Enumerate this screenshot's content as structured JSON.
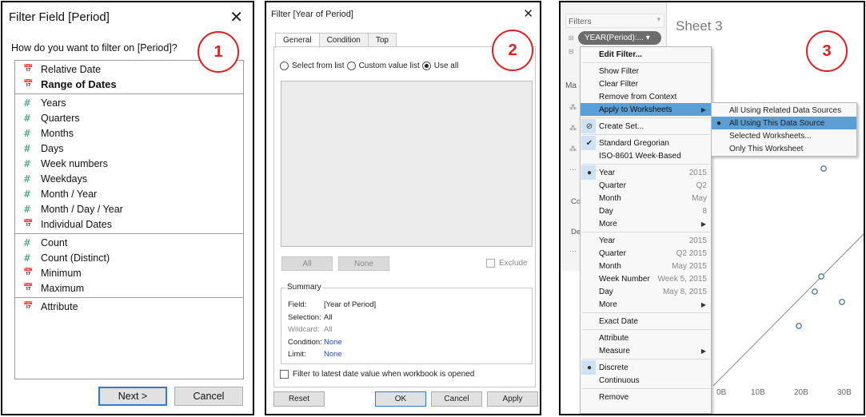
{
  "badges": [
    "1",
    "2",
    "3"
  ],
  "filter_field": {
    "title": "Filter Field [Period]",
    "close_glyph": "✕",
    "question": "How do you want to filter on [Period]?",
    "groups": [
      [
        {
          "label": "Relative Date",
          "icon": "calendar-icon",
          "glyph": "📅"
        },
        {
          "label": "Range of Dates",
          "icon": "calendar-icon",
          "glyph": "📅",
          "bold": true
        }
      ],
      [
        {
          "label": "Years",
          "icon": "hash-icon",
          "glyph": "#"
        },
        {
          "label": "Quarters",
          "icon": "hash-icon",
          "glyph": "#"
        },
        {
          "label": "Months",
          "icon": "hash-icon",
          "glyph": "#"
        },
        {
          "label": "Days",
          "icon": "hash-icon",
          "glyph": "#"
        },
        {
          "label": "Week numbers",
          "icon": "hash-icon",
          "glyph": "#"
        },
        {
          "label": "Weekdays",
          "icon": "hash-icon",
          "glyph": "#"
        },
        {
          "label": "Month / Year",
          "icon": "hash-icon",
          "glyph": "#"
        },
        {
          "label": "Month / Day / Year",
          "icon": "hash-icon",
          "glyph": "#"
        },
        {
          "label": "Individual Dates",
          "icon": "calendar-icon",
          "glyph": "📅"
        }
      ],
      [
        {
          "label": "Count",
          "icon": "hash-icon",
          "glyph": "#"
        },
        {
          "label": "Count (Distinct)",
          "icon": "hash-icon",
          "glyph": "#"
        },
        {
          "label": "Minimum",
          "icon": "calendar-icon",
          "glyph": "📅"
        },
        {
          "label": "Maximum",
          "icon": "calendar-icon",
          "glyph": "📅"
        }
      ],
      [
        {
          "label": "Attribute",
          "icon": "calendar-icon",
          "glyph": "📅"
        }
      ]
    ],
    "next_label": "Next >",
    "cancel_label": "Cancel"
  },
  "filter_year": {
    "title": "Filter [Year of Period]",
    "close_glyph": "✕",
    "tabs": [
      "General",
      "Condition",
      "Top"
    ],
    "active_tab": "General",
    "radios": [
      {
        "label": "Select from list",
        "selected": false
      },
      {
        "label": "Custom value list",
        "selected": false
      },
      {
        "label": "Use all",
        "selected": true
      }
    ],
    "all_label": "All",
    "none_label": "None",
    "exclude_label": "Exclude",
    "summary": {
      "legend": "Summary",
      "field_key": "Field:",
      "field_val": "[Year of Period]",
      "selection_key": "Selection:",
      "selection_val": "All",
      "wildcard_key": "Wildcard:",
      "wildcard_val": "All",
      "condition_key": "Condition:",
      "condition_val": "None",
      "limit_key": "Limit:",
      "limit_val": "None"
    },
    "latest_label": "Filter to latest date value when workbook is opened",
    "reset_label": "Reset",
    "ok_label": "OK",
    "cancel_label": "Cancel",
    "apply_label": "Apply"
  },
  "worksheet": {
    "filters_label": "Filters",
    "pill_label": "YEAR(Period):... ▾",
    "marks_stub": "Ma",
    "color_stub": "Co",
    "detail_stub": "De",
    "sheet_title": "Sheet 3",
    "x_ticks": [
      "0B",
      "10B",
      "20B",
      "30B"
    ],
    "menu": [
      {
        "label": "Edit Filter...",
        "bold": true
      },
      {
        "sep": true
      },
      {
        "label": "Show Filter"
      },
      {
        "label": "Clear Filter"
      },
      {
        "label": "Remove from Context"
      },
      {
        "label": "Apply to Worksheets",
        "submenu": true,
        "highlight": true
      },
      {
        "sep": true
      },
      {
        "label": "Create Set...",
        "lead": "⊘"
      },
      {
        "sep": true
      },
      {
        "label": "Standard Gregorian",
        "lead": "✔"
      },
      {
        "label": "ISO-8601 Week-Based"
      },
      {
        "sep": true
      },
      {
        "label": "Year",
        "value": "2015",
        "lead": "●"
      },
      {
        "label": "Quarter",
        "value": "Q2"
      },
      {
        "label": "Month",
        "value": "May"
      },
      {
        "label": "Day",
        "value": "8"
      },
      {
        "label": "More",
        "submenu": true
      },
      {
        "sep": true
      },
      {
        "label": "Year",
        "value": "2015"
      },
      {
        "label": "Quarter",
        "value": "Q2 2015"
      },
      {
        "label": "Month",
        "value": "May 2015"
      },
      {
        "label": "Week Number",
        "value": "Week 5, 2015"
      },
      {
        "label": "Day",
        "value": "May 8, 2015"
      },
      {
        "label": "More",
        "submenu": true
      },
      {
        "sep": true
      },
      {
        "label": "Exact Date"
      },
      {
        "sep": true
      },
      {
        "label": "Attribute"
      },
      {
        "label": "Measure",
        "submenu": true
      },
      {
        "sep": true
      },
      {
        "label": "Discrete",
        "lead": "●"
      },
      {
        "label": "Continuous"
      },
      {
        "sep": true
      },
      {
        "label": "Remove"
      }
    ],
    "submenu": [
      {
        "label": "All Using Related Data Sources"
      },
      {
        "label": "All Using This Data Source",
        "selected": true,
        "highlight": true
      },
      {
        "label": "Selected Worksheets..."
      },
      {
        "label": "Only This Worksheet"
      }
    ]
  },
  "colors": {
    "accent": "#2f78d4",
    "badge": "#e31e1e",
    "menu_highlight": "#5b9fd6",
    "icon_green": "#2b9a78"
  }
}
